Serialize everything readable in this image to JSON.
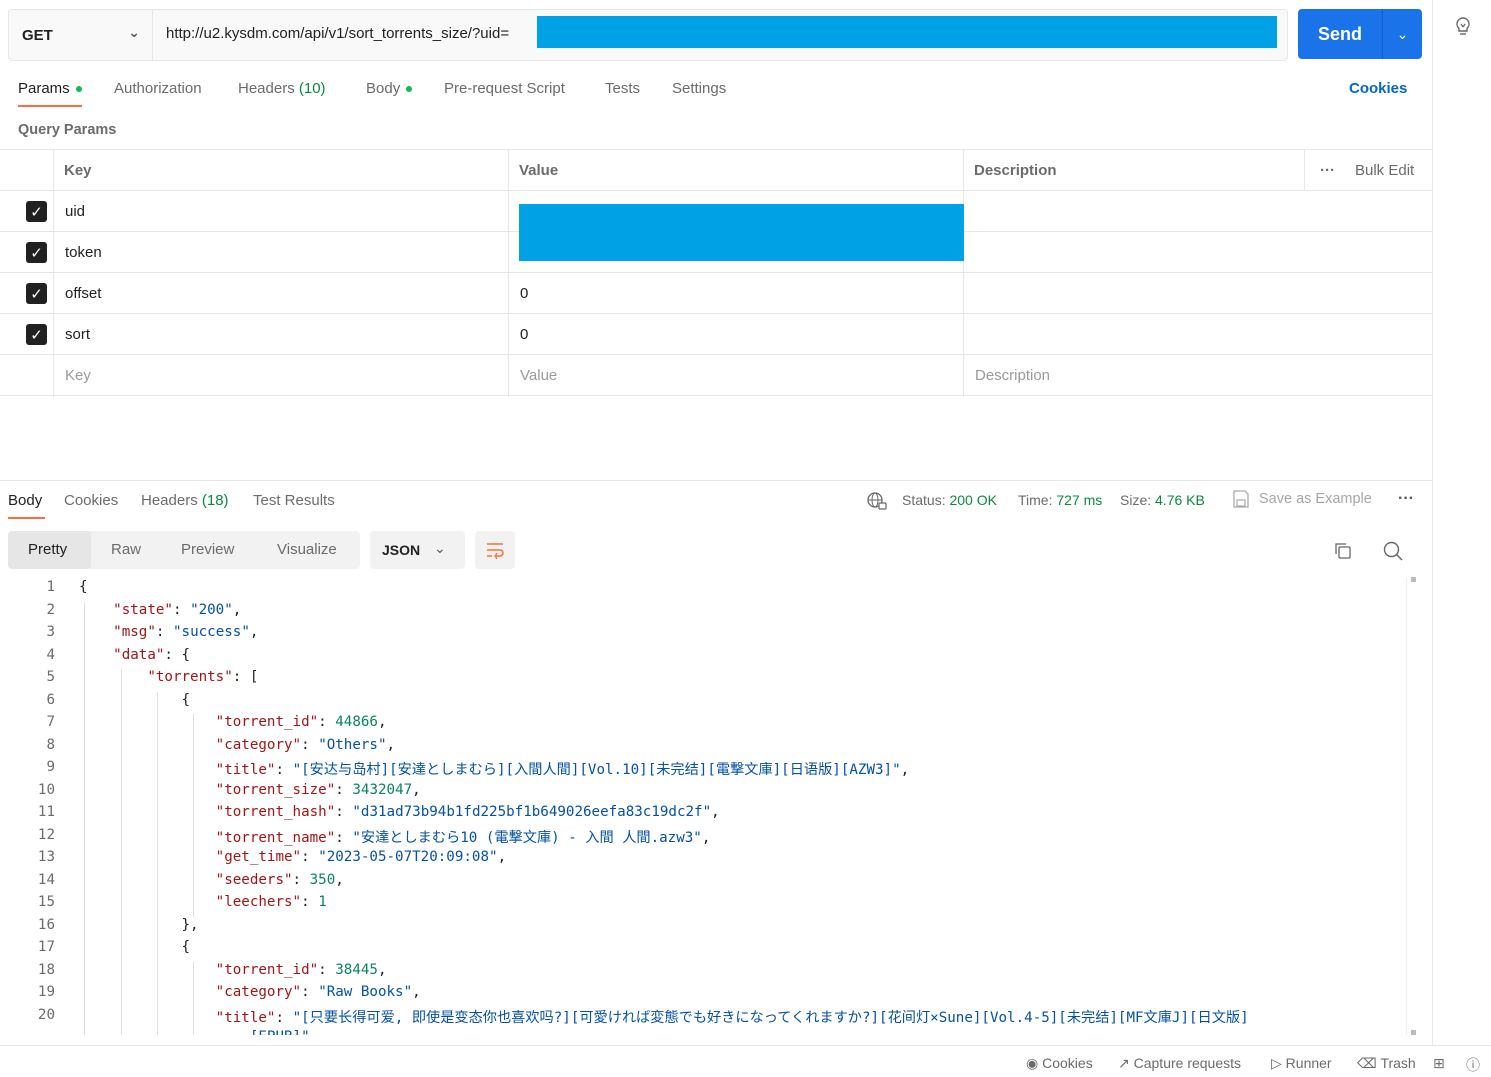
{
  "request": {
    "method": "GET",
    "url": "http://u2.kysdm.com/api/v1/sort_torrents_size/?uid=",
    "send_label": "Send"
  },
  "req_tabs": [
    {
      "label": "Params",
      "dot": true
    },
    {
      "label": "Authorization"
    },
    {
      "label": "Headers",
      "count": "(10)"
    },
    {
      "label": "Body",
      "dot": true
    },
    {
      "label": "Pre-request Script"
    },
    {
      "label": "Tests"
    },
    {
      "label": "Settings"
    }
  ],
  "cookies_link": "Cookies",
  "query_params_title": "Query Params",
  "params_table": {
    "headers": {
      "key": "Key",
      "value": "Value",
      "description": "Description",
      "bulk_edit": "Bulk Edit"
    },
    "rows": [
      {
        "key": "uid",
        "value": "",
        "checked": true
      },
      {
        "key": "token",
        "value": "",
        "checked": true
      },
      {
        "key": "offset",
        "value": "0",
        "checked": true
      },
      {
        "key": "sort",
        "value": "0",
        "checked": true
      }
    ],
    "placeholders": {
      "key": "Key",
      "value": "Value",
      "description": "Description"
    }
  },
  "resp_tabs": [
    {
      "label": "Body"
    },
    {
      "label": "Cookies"
    },
    {
      "label": "Headers",
      "count": "(18)"
    },
    {
      "label": "Test Results"
    }
  ],
  "response_meta": {
    "status_label": "Status:",
    "status": "200 OK",
    "time_label": "Time:",
    "time": "727 ms",
    "size_label": "Size:",
    "size": "4.76 KB",
    "save_example": "Save as Example"
  },
  "view_modes": [
    "Pretty",
    "Raw",
    "Preview",
    "Visualize"
  ],
  "format": "JSON",
  "code_lines": [
    "{",
    "    \"state\": \"200\",",
    "    \"msg\": \"success\",",
    "    \"data\": {",
    "        \"torrents\": [",
    "            {",
    "                \"torrent_id\": 44866,",
    "                \"category\": \"Others\",",
    "                \"title\": \"[安达与岛村][安達としまむら][入間人間][Vol.10][未完结][電撃文庫][日语版][AZW3]\",",
    "                \"torrent_size\": 3432047,",
    "                \"torrent_hash\": \"d31ad73b94b1fd225bf1b649026eefa83c19dc2f\",",
    "                \"torrent_name\": \"安達としまむら10 (電撃文庫) - 入間 人間.azw3\",",
    "                \"get_time\": \"2023-05-07T20:09:08\",",
    "                \"seeders\": 350,",
    "                \"leechers\": 1",
    "            },",
    "            {",
    "                \"torrent_id\": 38445,",
    "                \"category\": \"Raw Books\",",
    "                \"title\": \"[只要长得可爱, 即使是变态你也喜欢吗?][可愛ければ変態でも好きになってくれますか?][花间灯×Sune][Vol.4-5][未完结][MF文庫J][日文版]",
    "                    [EPUB]\","
  ],
  "footer": {
    "cookies": "Cookies",
    "capture": "Capture requests",
    "runner": "Runner",
    "trash": "Trash"
  },
  "colors": {
    "accent": "#ff6c37",
    "send": "#1a73e8",
    "redact": "#00a2e6",
    "ok": "#0cbb52"
  }
}
